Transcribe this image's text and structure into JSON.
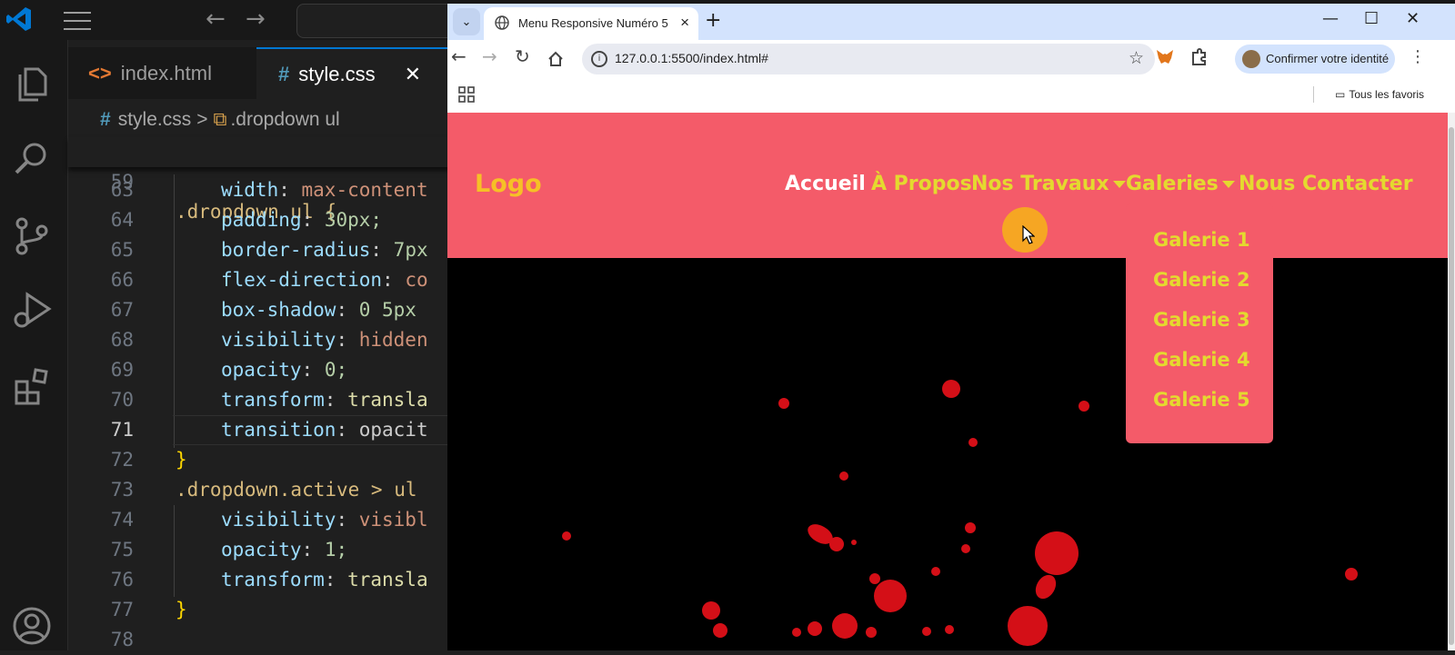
{
  "vscode": {
    "tabs": [
      {
        "label": "index.html",
        "icon": "<>"
      },
      {
        "label": "style.css",
        "icon": "#"
      }
    ],
    "close_glyph": "✕",
    "breadcrumb": {
      "file": "style.css",
      "separator": ">",
      "symbol": ".dropdown ul"
    },
    "sticky_line": {
      "number": "59",
      "text": ".dropdown ul {"
    },
    "lines": [
      {
        "number": "63",
        "prop": "width",
        "value": "max-content"
      },
      {
        "number": "64",
        "prop": "padding",
        "value": "30px;"
      },
      {
        "number": "65",
        "prop": "border-radius",
        "value": "7px"
      },
      {
        "number": "66",
        "prop": "flex-direction",
        "value": "co"
      },
      {
        "number": "67",
        "prop": "box-shadow",
        "value": "0 5px"
      },
      {
        "number": "68",
        "prop": "visibility",
        "value": "hidden"
      },
      {
        "number": "69",
        "prop": "opacity",
        "value": "0;"
      },
      {
        "number": "70",
        "prop": "transform",
        "value": "transla"
      },
      {
        "number": "71",
        "prop": "transition",
        "value": "opacit"
      },
      {
        "number": "72",
        "brace": "}"
      },
      {
        "number": "73",
        "selector": ".dropdown.active > ul"
      },
      {
        "number": "74",
        "prop": "visibility",
        "value": "visibl"
      },
      {
        "number": "75",
        "prop": "opacity",
        "value": "1;"
      },
      {
        "number": "76",
        "prop": "transform",
        "value": "transla"
      },
      {
        "number": "77",
        "brace": "}"
      },
      {
        "number": "78"
      }
    ]
  },
  "browser": {
    "tab_title": "Menu Responsive Numéro 5",
    "url": "127.0.0.1:5500/index.html#",
    "profile_label": "Confirmer votre identité",
    "bookmarks_label": "Tous les favoris",
    "accent": "#d3e3fd"
  },
  "page": {
    "logo": "Logo",
    "nav": [
      {
        "label": "Accueil",
        "active": true
      },
      {
        "label": "À Propos"
      },
      {
        "label": "Nos Travaux",
        "dropdown": true
      },
      {
        "label": "Galeries",
        "dropdown": true
      },
      {
        "label": "Nous Contacter"
      }
    ],
    "dropdown_items": [
      "Galerie 1",
      "Galerie 2",
      "Galerie 3",
      "Galerie 4",
      "Galerie 5"
    ],
    "colors": {
      "navbar": "#f45b69",
      "nav_text": "#e4d92f",
      "logo": "#f6c026",
      "active": "#ffffff",
      "background": "#000000"
    }
  }
}
